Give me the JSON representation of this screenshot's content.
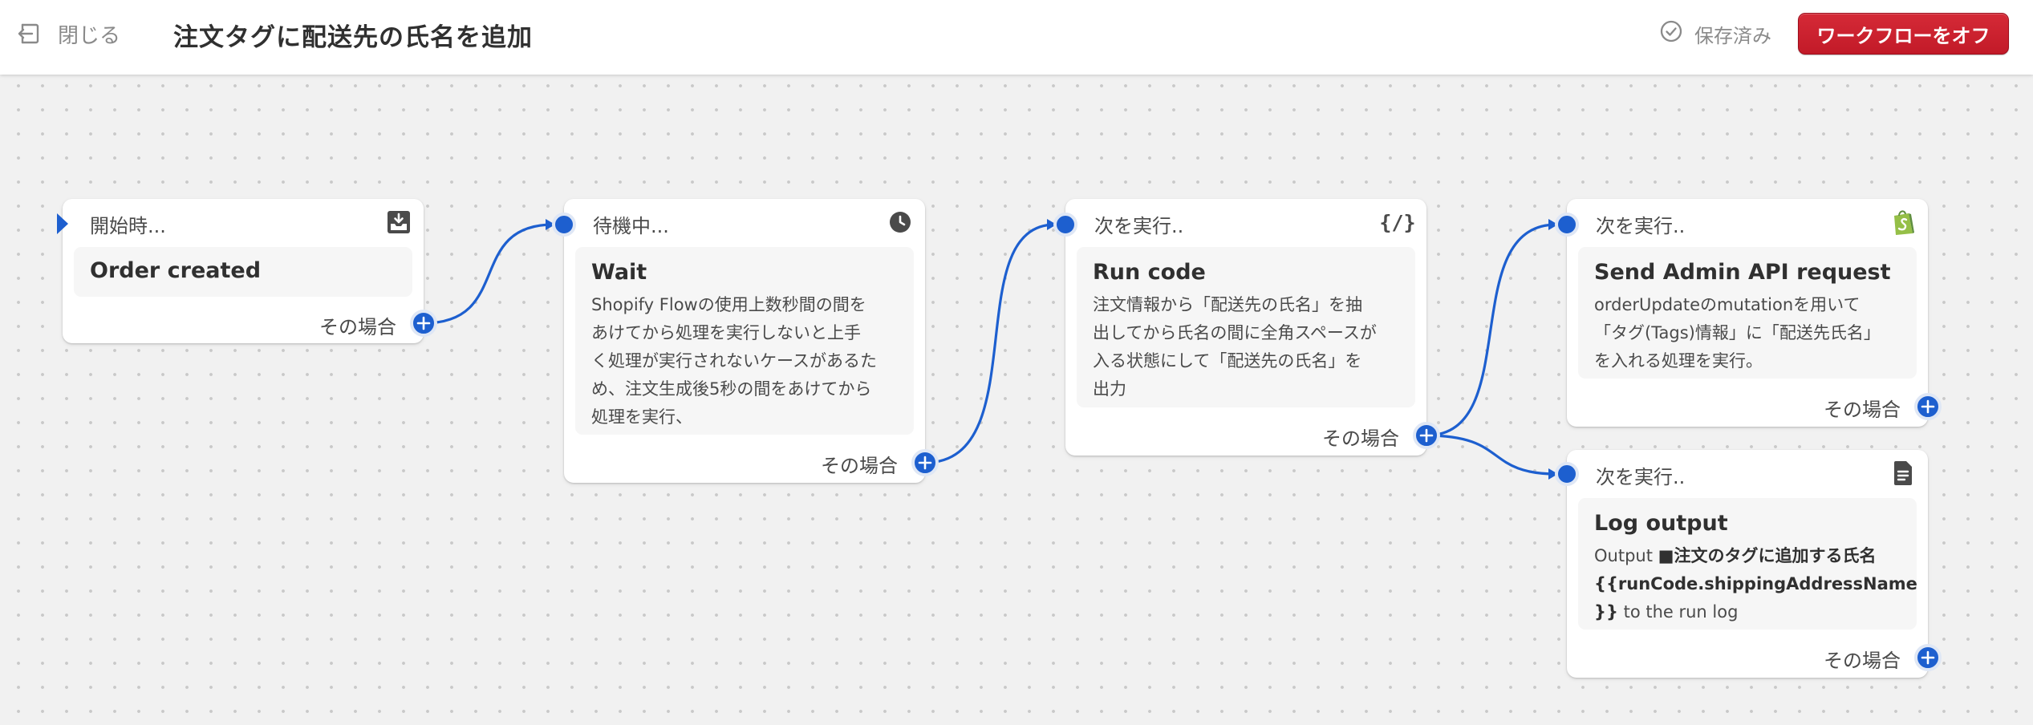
{
  "header": {
    "close_label": "閉じる",
    "title": "注文タグに配送先の氏名を追加",
    "saved_label": "保存済み",
    "turn_off_label": "ワークフローをオフ"
  },
  "colors": {
    "accent": "#1d5fcf",
    "danger": "#c21a28",
    "shopify_green": "#95bf47"
  },
  "nodes": [
    {
      "label": "開始時...",
      "title": "Order created",
      "icon": "download-tray-icon",
      "footer": "その場合"
    },
    {
      "label": "待機中...",
      "title": "Wait",
      "icon": "clock-icon",
      "description_lines": [
        "Shopify Flowの使用上数秒間の間を",
        "あけてから処理を実行しないと上手",
        "く処理が実行されないケースがあるた",
        "め、注文生成後5秒の間をあけてから",
        "処理を実行、"
      ],
      "footer": "その場合"
    },
    {
      "label": "次を実行..",
      "title": "Run code",
      "icon": "code-braces-icon",
      "icon_text": "{/}",
      "description_lines": [
        "注文情報から「配送先の氏名」を抽",
        "出してから氏名の間に全角スペースが",
        "入る状態にして「配送先の氏名」を",
        "出力"
      ],
      "footer": "その場合"
    },
    {
      "label": "次を実行..",
      "title": "Send Admin API request",
      "icon": "shopify-bag-icon",
      "description_lines": [
        "orderUpdateのmutationを用いて",
        "「タグ(Tags)情報」に「配送先氏名」",
        "を入れる処理を実行。"
      ],
      "footer": "その場合"
    },
    {
      "label": "次を実行..",
      "title": "Log output",
      "icon": "document-icon",
      "log_line1_prefix": "Output ",
      "log_line1_bold": "■注文のタグに追加する氏名",
      "log_line2_bold": "{{runCode.shippingAddressName",
      "log_line3_bold": "}}",
      "log_line3_rest": " to the run log",
      "footer": "その場合"
    }
  ]
}
